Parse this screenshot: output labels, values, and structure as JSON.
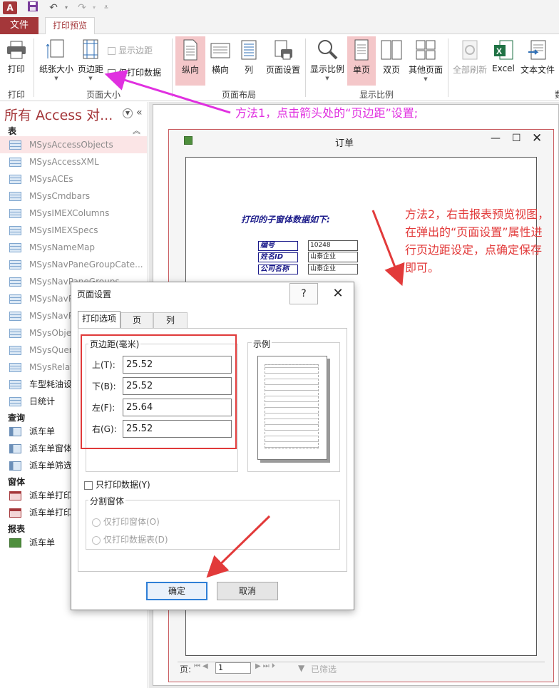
{
  "colors": {
    "accent": "#a4373a",
    "highlight": "#f4c7c9",
    "annotation_magenta": "#e030e0",
    "annotation_red": "#e23a3a"
  },
  "app": {
    "icon_text": "A"
  },
  "qat": {
    "save_icon": "save-icon",
    "undo_icon": "undo-icon",
    "redo_icon": "redo-icon"
  },
  "tabs": {
    "file": "文件",
    "print_preview": "打印预览"
  },
  "ribbon": {
    "print": {
      "button": "打印",
      "group": "打印"
    },
    "page_size": {
      "paper_size": "纸张大小",
      "margins": "页边距",
      "show_margins": "显示边距",
      "print_data_only": "仅打印数据",
      "group": "页面大小"
    },
    "page_layout": {
      "portrait": "纵向",
      "landscape": "横向",
      "columns": "列",
      "page_setup": "页面设置",
      "group": "页面布局"
    },
    "zoom": {
      "zoom": "显示比例",
      "one_page": "单页",
      "two_pages": "双页",
      "more_pages": "其他页面",
      "group": "显示比例"
    },
    "data": {
      "refresh_all": "全部刷新",
      "excel": "Excel",
      "text_file": "文本文件",
      "group_partial": "数"
    }
  },
  "nav": {
    "title": "所有 Access 对...",
    "sections": {
      "tables": "表",
      "queries": "查询",
      "forms": "窗体",
      "reports": "报表"
    },
    "tables": [
      "MSysAccessObjects",
      "MSysAccessXML",
      "MSysACEs",
      "MSysCmdbars",
      "MSysIMEXColumns",
      "MSysIMEXSpecs",
      "MSysNameMap",
      "MSysNavPaneGroupCate...",
      "MSysNavPaneGroups",
      "MSysNavP",
      "MSysNavP",
      "MSysObje",
      "MSysQuer",
      "MSysRelat",
      "车型耗油设",
      "日统计"
    ],
    "queries": [
      "派车单",
      "派车单窗体",
      "派车单筛选"
    ],
    "forms": [
      "派车单打印",
      "派车单打印"
    ],
    "reports": [
      "派车单"
    ]
  },
  "report": {
    "window_title": "订单",
    "heading": "打印的子窗体数据如下:",
    "fields": [
      {
        "label": "编号",
        "value": "10248"
      },
      {
        "label": "姓名ID",
        "value": "山泰企业"
      },
      {
        "label": "公司名称",
        "value": "山泰企业"
      }
    ],
    "record_bar": {
      "page_label": "页:",
      "page_value": "1",
      "filter": "已筛选"
    }
  },
  "dialog": {
    "title": "页面设置",
    "help": "?",
    "tabs": [
      "打印选项",
      "页",
      "列"
    ],
    "margins_legend": "页边距(毫米)",
    "margins": [
      {
        "label": "上(T):",
        "value": "25.52"
      },
      {
        "label": "下(B):",
        "value": "25.52"
      },
      {
        "label": "左(F):",
        "value": "25.64"
      },
      {
        "label": "右(G):",
        "value": "25.52"
      }
    ],
    "sample_legend": "示例",
    "print_data_only": "只打印数据(Y)",
    "split_legend": "分割窗体",
    "split_options": [
      "仅打印窗体(O)",
      "仅打印数据表(D)"
    ],
    "ok": "确定",
    "cancel": "取消"
  },
  "annotations": {
    "method1": "方法1，点击箭头处的“页边距”设置;",
    "method2": "方法2，右击报表预览视图，在弹出的“页面设置”属性进行页边距设定，点确定保存即可。"
  }
}
